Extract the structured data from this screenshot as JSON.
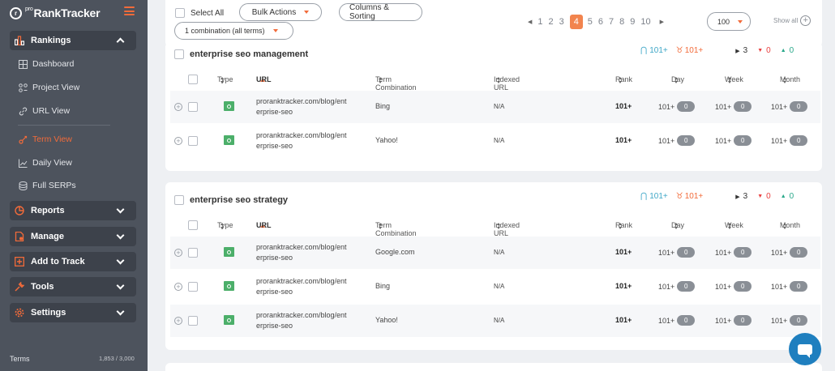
{
  "app": {
    "brand_prefix": "pro",
    "brand_name": "RankTracker",
    "brand_mark": "r"
  },
  "sidebar": {
    "groups": [
      {
        "label": "Rankings",
        "icon": "rankings-icon",
        "expanded": true
      },
      {
        "label": "Reports",
        "icon": "reports-icon"
      },
      {
        "label": "Manage",
        "icon": "manage-icon"
      },
      {
        "label": "Add to Track",
        "icon": "add-icon"
      },
      {
        "label": "Tools",
        "icon": "tools-icon"
      },
      {
        "label": "Settings",
        "icon": "settings-icon"
      }
    ],
    "items": [
      {
        "label": "Dashboard",
        "icon": "dashboard-icon"
      },
      {
        "label": "Project View",
        "icon": "project-view-icon"
      },
      {
        "label": "URL View",
        "icon": "link-icon"
      },
      {
        "label": "Term View",
        "icon": "term-view-icon",
        "active": true
      },
      {
        "label": "Daily View",
        "icon": "chart-icon"
      },
      {
        "label": "Full SERPs",
        "icon": "serp-icon"
      }
    ],
    "footer_terms": "Terms",
    "footer_count": "1,853 / 3,000"
  },
  "toolbar": {
    "select_all": "Select All",
    "bulk_actions": "Bulk Actions",
    "columns_sorting": "Columns & Sorting",
    "combination": "1 combination (all terms)",
    "pages": [
      "1",
      "2",
      "3",
      "4",
      "5",
      "6",
      "7",
      "8",
      "9",
      "10"
    ],
    "current_page": "4",
    "per_page": "100",
    "show_all": "Show all"
  },
  "columns": {
    "type": "Type",
    "url": "URL",
    "term": "Term Combination",
    "indexed": "Indexed URL",
    "rank": "Rank",
    "day": "Day",
    "week": "Week",
    "month": "Month"
  },
  "groups": [
    {
      "title": "enterprise seo management",
      "stats": {
        "best": "101+",
        "trophy": "101+",
        "flat": "3",
        "down": "0",
        "up": "0"
      },
      "rows": [
        {
          "url1": "proranktracker.com/blog/ent",
          "url2": "erprise-seo",
          "term": "Bing",
          "indexed": "N/A",
          "rank": "101+",
          "day": "101+",
          "day_chg": "0",
          "week": "101+",
          "week_chg": "0",
          "month": "101+",
          "month_chg": "0"
        },
        {
          "url1": "proranktracker.com/blog/ent",
          "url2": "erprise-seo",
          "term": "Yahoo!",
          "indexed": "N/A",
          "rank": "101+",
          "day": "101+",
          "day_chg": "0",
          "week": "101+",
          "week_chg": "0",
          "month": "101+",
          "month_chg": "0"
        }
      ]
    },
    {
      "title": "enterprise seo strategy",
      "stats": {
        "best": "101+",
        "trophy": "101+",
        "flat": "3",
        "down": "0",
        "up": "0"
      },
      "rows": [
        {
          "url1": "proranktracker.com/blog/ent",
          "url2": "erprise-seo",
          "term": "Google.com",
          "indexed": "N/A",
          "rank": "101+",
          "day": "101+",
          "day_chg": "0",
          "week": "101+",
          "week_chg": "0",
          "month": "101+",
          "month_chg": "0"
        },
        {
          "url1": "proranktracker.com/blog/ent",
          "url2": "erprise-seo",
          "term": "Bing",
          "indexed": "N/A",
          "rank": "101+",
          "day": "101+",
          "day_chg": "0",
          "week": "101+",
          "week_chg": "0",
          "month": "101+",
          "month_chg": "0"
        },
        {
          "url1": "proranktracker.com/blog/ent",
          "url2": "erprise-seo",
          "term": "Yahoo!",
          "indexed": "N/A",
          "rank": "101+",
          "day": "101+",
          "day_chg": "0",
          "week": "101+",
          "week_chg": "0",
          "month": "101+",
          "month_chg": "0"
        }
      ]
    }
  ],
  "colors": {
    "accent": "#f26b3a",
    "sidebar_bg": "#4d535d",
    "engine_green": "#4caf6a",
    "chat_blue": "#1f7fbf"
  }
}
